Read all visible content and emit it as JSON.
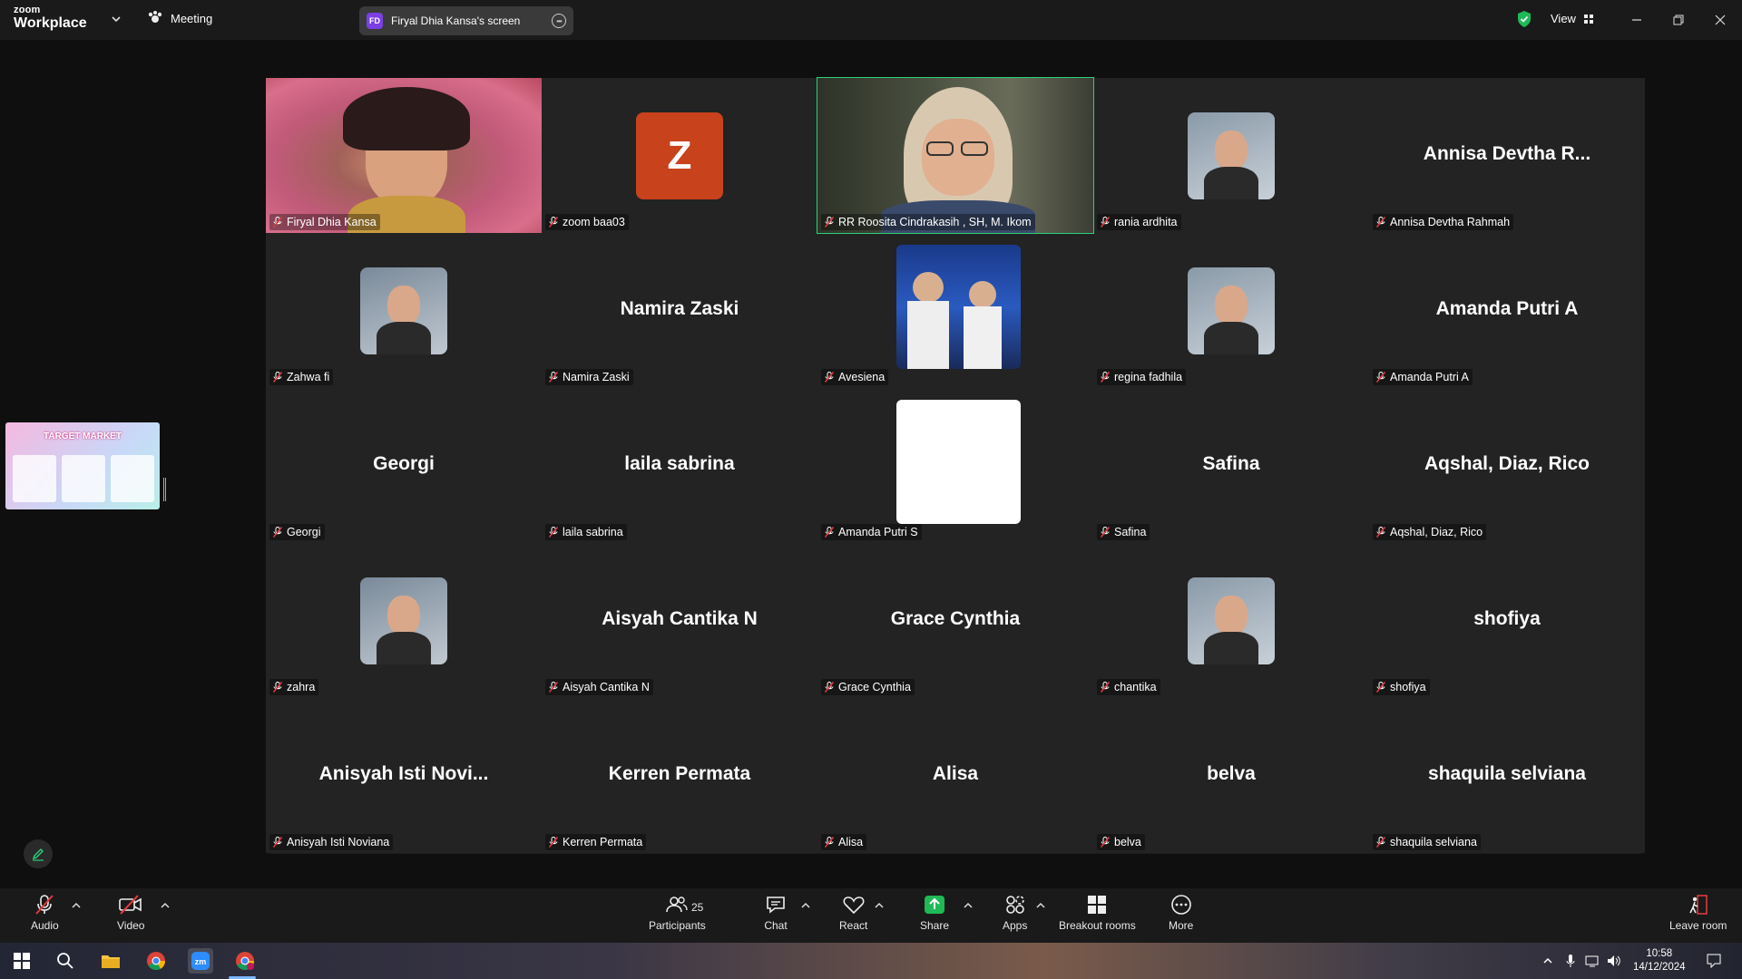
{
  "titlebar": {
    "brand_small": "zoom",
    "brand_big": "Workplace",
    "meeting_label": "Meeting",
    "screen_badge": "FD",
    "screen_label": "Firyal Dhia Kansa's screen",
    "view_label": "View"
  },
  "tiles": [
    {
      "name": "Firyal Dhia Kansa",
      "big": "",
      "kind": "video"
    },
    {
      "name": "zoom baa03",
      "big": "",
      "kind": "z-avatar",
      "initial": "Z"
    },
    {
      "name": "RR Roosita Cindrakasih , SH, M. Ikom",
      "big": "",
      "kind": "video-active"
    },
    {
      "name": "rania ardhita",
      "big": "",
      "kind": "photo"
    },
    {
      "name": "Annisa Devtha Rahmah",
      "big": "Annisa Devtha R...",
      "kind": "name"
    },
    {
      "name": "Zahwa fi",
      "big": "",
      "kind": "photo"
    },
    {
      "name": "Namira Zaski",
      "big": "Namira Zaski",
      "kind": "name"
    },
    {
      "name": "Avesiena",
      "big": "",
      "kind": "photo-large"
    },
    {
      "name": "regina fadhila",
      "big": "",
      "kind": "photo"
    },
    {
      "name": "Amanda Putri A",
      "big": "Amanda Putri A",
      "kind": "name"
    },
    {
      "name": "Georgi",
      "big": "Georgi",
      "kind": "name"
    },
    {
      "name": "laila sabrina",
      "big": "laila sabrina",
      "kind": "name"
    },
    {
      "name": "Amanda Putri S",
      "big": "",
      "kind": "white"
    },
    {
      "name": "Safina",
      "big": "Safina",
      "kind": "name"
    },
    {
      "name": "Aqshal, Diaz, Rico",
      "big": "Aqshal, Diaz, Rico",
      "kind": "name"
    },
    {
      "name": "zahra",
      "big": "",
      "kind": "photo"
    },
    {
      "name": "Aisyah Cantika N",
      "big": "Aisyah Cantika N",
      "kind": "name"
    },
    {
      "name": "Grace Cynthia",
      "big": "Grace Cynthia",
      "kind": "name"
    },
    {
      "name": "chantika",
      "big": "",
      "kind": "photo"
    },
    {
      "name": "shofiya",
      "big": "shofiya",
      "kind": "name"
    },
    {
      "name": "Anisyah Isti Noviana",
      "big": "Anisyah Isti Novi...",
      "kind": "name"
    },
    {
      "name": "Kerren Permata",
      "big": "Kerren Permata",
      "kind": "name"
    },
    {
      "name": "Alisa",
      "big": "Alisa",
      "kind": "name"
    },
    {
      "name": "belva",
      "big": "belva",
      "kind": "name"
    },
    {
      "name": "shaquila selviana",
      "big": "shaquila selviana",
      "kind": "name"
    }
  ],
  "thumbnail": {
    "title": "TARGET MARKET"
  },
  "toolbar": {
    "audio": "Audio",
    "video": "Video",
    "participants": "Participants",
    "participants_count": "25",
    "chat": "Chat",
    "react": "React",
    "share": "Share",
    "apps": "Apps",
    "breakout": "Breakout rooms",
    "more": "More",
    "leave": "Leave room"
  },
  "taskbar": {
    "time": "10:58",
    "date": "14/12/2024"
  },
  "colors": {
    "active_speaker": "#2bd27a",
    "share_green": "#1fb955",
    "leave_red": "#e0393e",
    "z_avatar": "#c8421c"
  }
}
